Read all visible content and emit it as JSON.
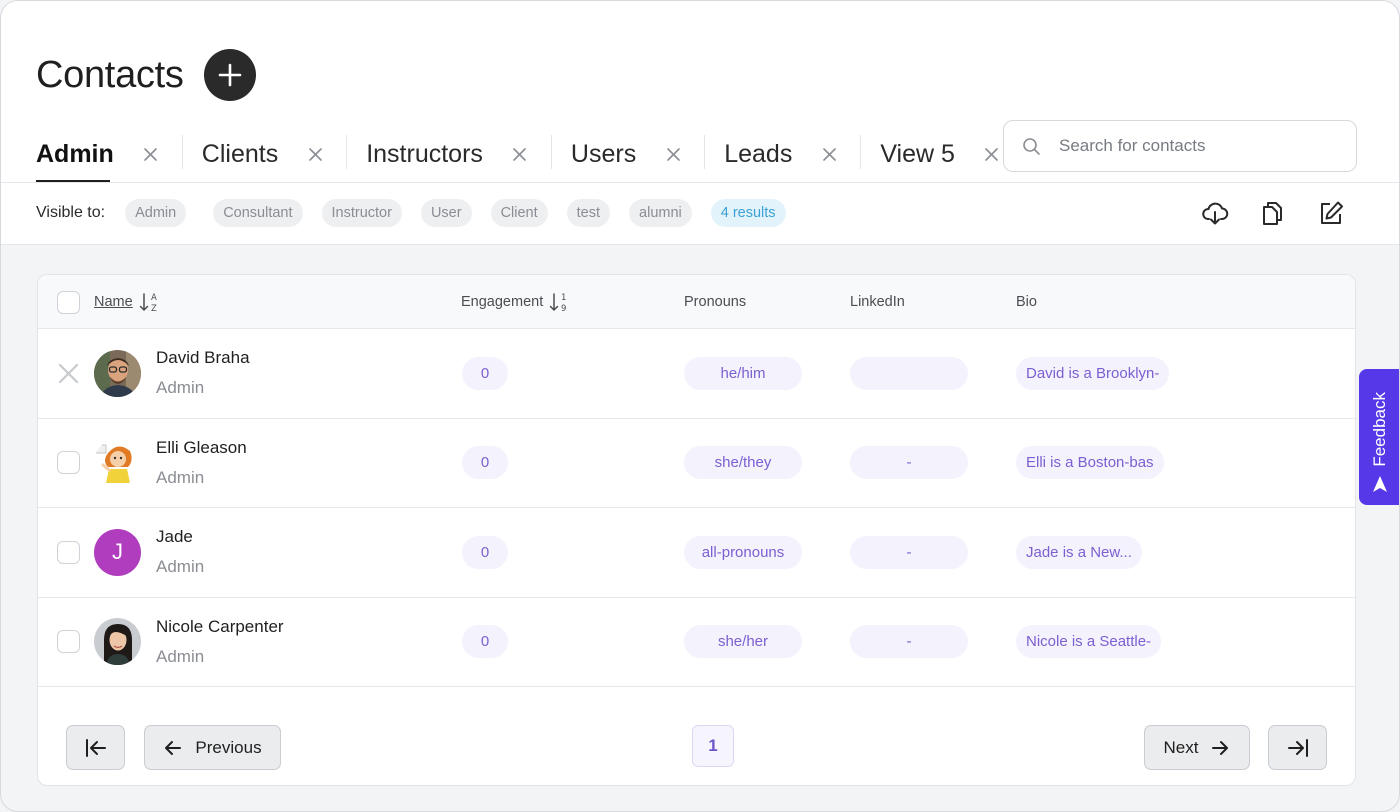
{
  "page": {
    "title": "Contacts"
  },
  "tabs": [
    {
      "label": "Admin",
      "active": true
    },
    {
      "label": "Clients"
    },
    {
      "label": "Instructors"
    },
    {
      "label": "Users"
    },
    {
      "label": "Leads"
    },
    {
      "label": "View 5"
    }
  ],
  "search": {
    "placeholder": "Search for contacts",
    "value": ""
  },
  "visibility": {
    "label": "Visible to:",
    "roles": [
      "Admin",
      "Consultant",
      "Instructor",
      "User",
      "Client",
      "test",
      "alumni"
    ],
    "results": "4 results"
  },
  "table": {
    "columns": {
      "name": "Name",
      "engagement": "Engagement",
      "pronouns": "Pronouns",
      "linkedin": "LinkedIn",
      "bio": "Bio"
    },
    "sort_icons": {
      "name": "A↓Z",
      "engagement": "1↓9"
    },
    "rows": [
      {
        "name": "David Braha",
        "role": "Admin",
        "engagement": "0",
        "pronouns": "he/him",
        "linkedin": "",
        "bio": "David is a Brooklyn-",
        "avatar": "photo-man-glasses",
        "hovered": true
      },
      {
        "name": "Elli Gleason",
        "role": "Admin",
        "engagement": "0",
        "pronouns": "she/they",
        "linkedin": "-",
        "bio": "Elli is a Boston-bas",
        "avatar": "illustrated-character"
      },
      {
        "name": "Jade",
        "role": "Admin",
        "engagement": "0",
        "pronouns": "all-pronouns",
        "linkedin": "-",
        "bio": "Jade is a New...",
        "avatar_letter": "J",
        "avatar_color": "#b03cbe"
      },
      {
        "name": "Nicole Carpenter",
        "role": "Admin",
        "engagement": "0",
        "pronouns": "she/her",
        "linkedin": "-",
        "bio": "Nicole is a Seattle-",
        "avatar": "photo-woman"
      }
    ]
  },
  "pagination": {
    "previous": "Previous",
    "next": "Next",
    "current_page": "1"
  },
  "feedback": {
    "label": "Feedback"
  },
  "colors": {
    "accent": "#5638e8",
    "pill_text": "#7c5fd0",
    "pill_bg": "#f4f2fd",
    "results": "#3aa2d6"
  }
}
